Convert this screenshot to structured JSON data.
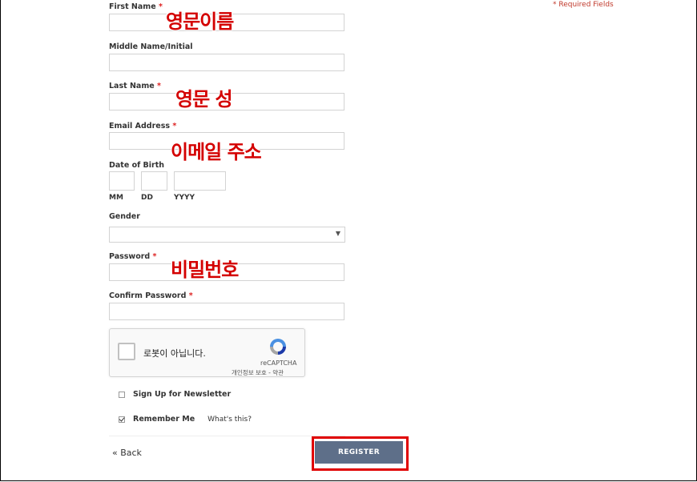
{
  "required_note": "* Required Fields",
  "fields": {
    "first_name": {
      "label": "First Name",
      "required": "*",
      "value": "",
      "annotation": "영문이름"
    },
    "middle_name": {
      "label": "Middle Name/Initial",
      "value": ""
    },
    "last_name": {
      "label": "Last Name",
      "required": "*",
      "value": "",
      "annotation": "영문 성"
    },
    "email": {
      "label": "Email Address",
      "required": "*",
      "value": "",
      "annotation": "이메일 주소"
    },
    "dob": {
      "label": "Date of Birth",
      "mm": "MM",
      "dd": "DD",
      "yyyy": "YYYY"
    },
    "gender": {
      "label": "Gender",
      "selected": ""
    },
    "password": {
      "label": "Password",
      "required": "*",
      "value": "",
      "annotation": "비밀번호"
    },
    "confirm_password": {
      "label": "Confirm Password",
      "required": "*",
      "value": ""
    }
  },
  "captcha": {
    "text": "로봇이 아닙니다.",
    "brand": "reCAPTCHA",
    "terms": "개인정보 보호 - 약관"
  },
  "newsletter": {
    "label": "Sign Up for Newsletter",
    "checked": false
  },
  "remember": {
    "label": "Remember Me",
    "checked": true,
    "help": "What's this?"
  },
  "back_label": "« Back",
  "register_label": "REGISTER",
  "colors": {
    "accent": "#5e6f89",
    "required": "#d22222",
    "annotation": "#d40000",
    "highlight": "#e00000"
  }
}
